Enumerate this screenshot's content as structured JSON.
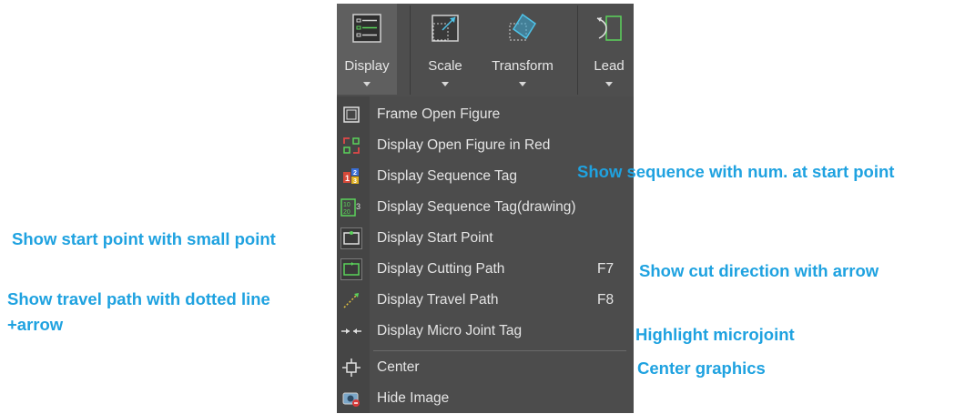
{
  "toolbar": {
    "tools": [
      {
        "label": "Display",
        "icon": "display-list-icon",
        "active": true
      },
      {
        "label": "Scale",
        "icon": "scale-icon"
      },
      {
        "label": "Transform",
        "icon": "transform-icon"
      },
      {
        "label": "Lead",
        "icon": "lead-icon"
      }
    ]
  },
  "menu": {
    "items": [
      {
        "label": "Frame Open Figure",
        "shortcut": "",
        "icon": "frame-open-figure-icon"
      },
      {
        "label": "Display Open Figure in Red",
        "shortcut": "",
        "icon": "open-figure-red-icon"
      },
      {
        "label": "Display Sequence Tag",
        "shortcut": "",
        "icon": "sequence-tag-icon"
      },
      {
        "label": "Display Sequence Tag(drawing)",
        "shortcut": "",
        "icon": "sequence-tag-drawing-icon"
      },
      {
        "label": "Display Start Point",
        "shortcut": "",
        "icon": "start-point-icon"
      },
      {
        "label": "Display Cutting Path",
        "shortcut": "F7",
        "icon": "cutting-path-icon"
      },
      {
        "label": "Display Travel Path",
        "shortcut": "F8",
        "icon": "travel-path-icon"
      },
      {
        "label": "Display Micro Joint Tag",
        "shortcut": "",
        "icon": "micro-joint-icon"
      },
      {
        "label": "Center",
        "shortcut": "",
        "icon": "center-icon"
      },
      {
        "label": "Hide Image",
        "shortcut": "",
        "icon": "hide-image-icon"
      }
    ]
  },
  "annotations": {
    "sequence": "Show sequence with num. at start point",
    "start_point": "Show start point with small point",
    "cut_direction": "Show cut direction with arrow",
    "travel_line1": "Show travel path with dotted line",
    "travel_line2": "+arrow",
    "microjoint": "Highlight microjoint",
    "center": "Center graphics"
  },
  "colors": {
    "annotation": "#1fa2e0",
    "menu_bg": "#4c4c4c",
    "menu_text": "#e4e4e4",
    "icon_green": "#5bd35b",
    "icon_red": "#e04848"
  }
}
